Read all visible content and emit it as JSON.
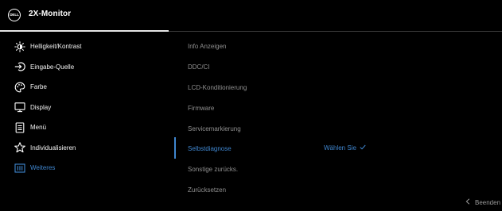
{
  "header": {
    "logo_text": "DELL",
    "title": "2X-Monitor"
  },
  "sidebar": {
    "items": [
      {
        "label": "Helligkeit/Kontrast",
        "icon": "brightness-icon"
      },
      {
        "label": "Eingabe-Quelle",
        "icon": "input-source-icon"
      },
      {
        "label": "Farbe",
        "icon": "color-palette-icon"
      },
      {
        "label": "Display",
        "icon": "display-icon"
      },
      {
        "label": "Menü",
        "icon": "menu-icon"
      },
      {
        "label": "Individualisieren",
        "icon": "star-icon"
      },
      {
        "label": "Weiteres",
        "icon": "others-icon",
        "active": true
      }
    ]
  },
  "content": {
    "items": [
      {
        "label": "Info Anzeigen"
      },
      {
        "label": "DDC/CI"
      },
      {
        "label": "LCD-Konditionierung"
      },
      {
        "label": "Firmware"
      },
      {
        "label": "Servicemarkierung"
      },
      {
        "label": "Selbstdiagnose",
        "active": true
      },
      {
        "label": "Sonstige zurücks."
      },
      {
        "label": "Zurücksetzen"
      }
    ],
    "selected_value": "Wählen Sie",
    "selected_value_icon": "check-icon"
  },
  "footer": {
    "exit_label": "Beenden",
    "exit_icon": "chevron-left-icon"
  },
  "colors": {
    "accent": "#3f86cf",
    "background": "#000000",
    "text": "#f2f2f2",
    "inactive_text": "#8f8f8f"
  }
}
